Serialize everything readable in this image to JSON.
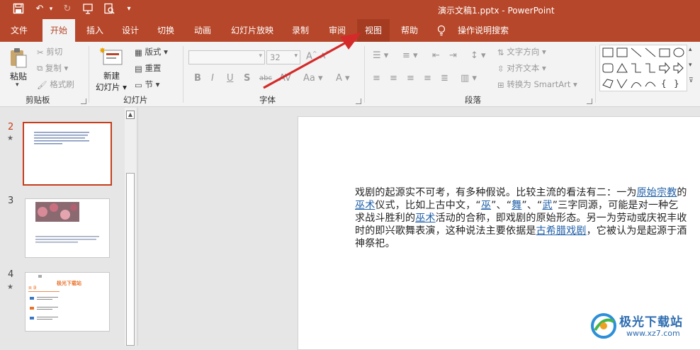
{
  "titlebar": {
    "doc_title": "演示文稿1.pptx  -  PowerPoint"
  },
  "tabs": [
    "文件",
    "开始",
    "插入",
    "设计",
    "切换",
    "动画",
    "幻灯片放映",
    "录制",
    "审阅",
    "视图",
    "帮助",
    "操作说明搜索"
  ],
  "ribbon": {
    "clipboard": {
      "paste": "粘贴",
      "cut": "剪切",
      "copy": "复制",
      "format_painter": "格式刷",
      "label": "剪贴板"
    },
    "slides": {
      "new_slide_1": "新建",
      "new_slide_2": "幻灯片",
      "layout": "版式",
      "reset": "重置",
      "section": "节",
      "label": "幻灯片"
    },
    "font": {
      "size": "32",
      "label": "字体"
    },
    "paragraph": {
      "text_direction": "文字方向",
      "align_text": "对齐文本",
      "smartart": "转换为 SmartArt",
      "label": "段落"
    }
  },
  "slides_panel": {
    "nums": [
      "2",
      "3",
      "4"
    ],
    "star": "★",
    "thumb4_title": "极光下载站",
    "thumb4_sub": "目 录"
  },
  "slide": {
    "t1": "戏剧的起源实不可考，有多种假说。比较主流的看法有二：一为",
    "l1": "原始宗教",
    "t2": "的",
    "l2": "巫术",
    "t3": "仪式，比如上古中文，“",
    "l3": "巫",
    "t4": "”、“",
    "l4": "舞",
    "t5": "”、“",
    "l5": "武",
    "t6": "”三字同源，可能是对一种乞求战斗胜利的",
    "l6": "巫术",
    "t7": "活动的合称，即戏剧的原始形态。另一为劳动或庆祝丰收时的即兴歌舞表演，这种说法主要依据是",
    "l7": "古希腊戏剧",
    "t8": "，它被认为是起源于酒神祭祀。"
  },
  "watermark": {
    "name": "极光下载站",
    "url": "www.xz7.com"
  },
  "colors": {
    "accent": "#b7472a",
    "link": "#1f5fa8",
    "arrow": "#d42a2a"
  }
}
